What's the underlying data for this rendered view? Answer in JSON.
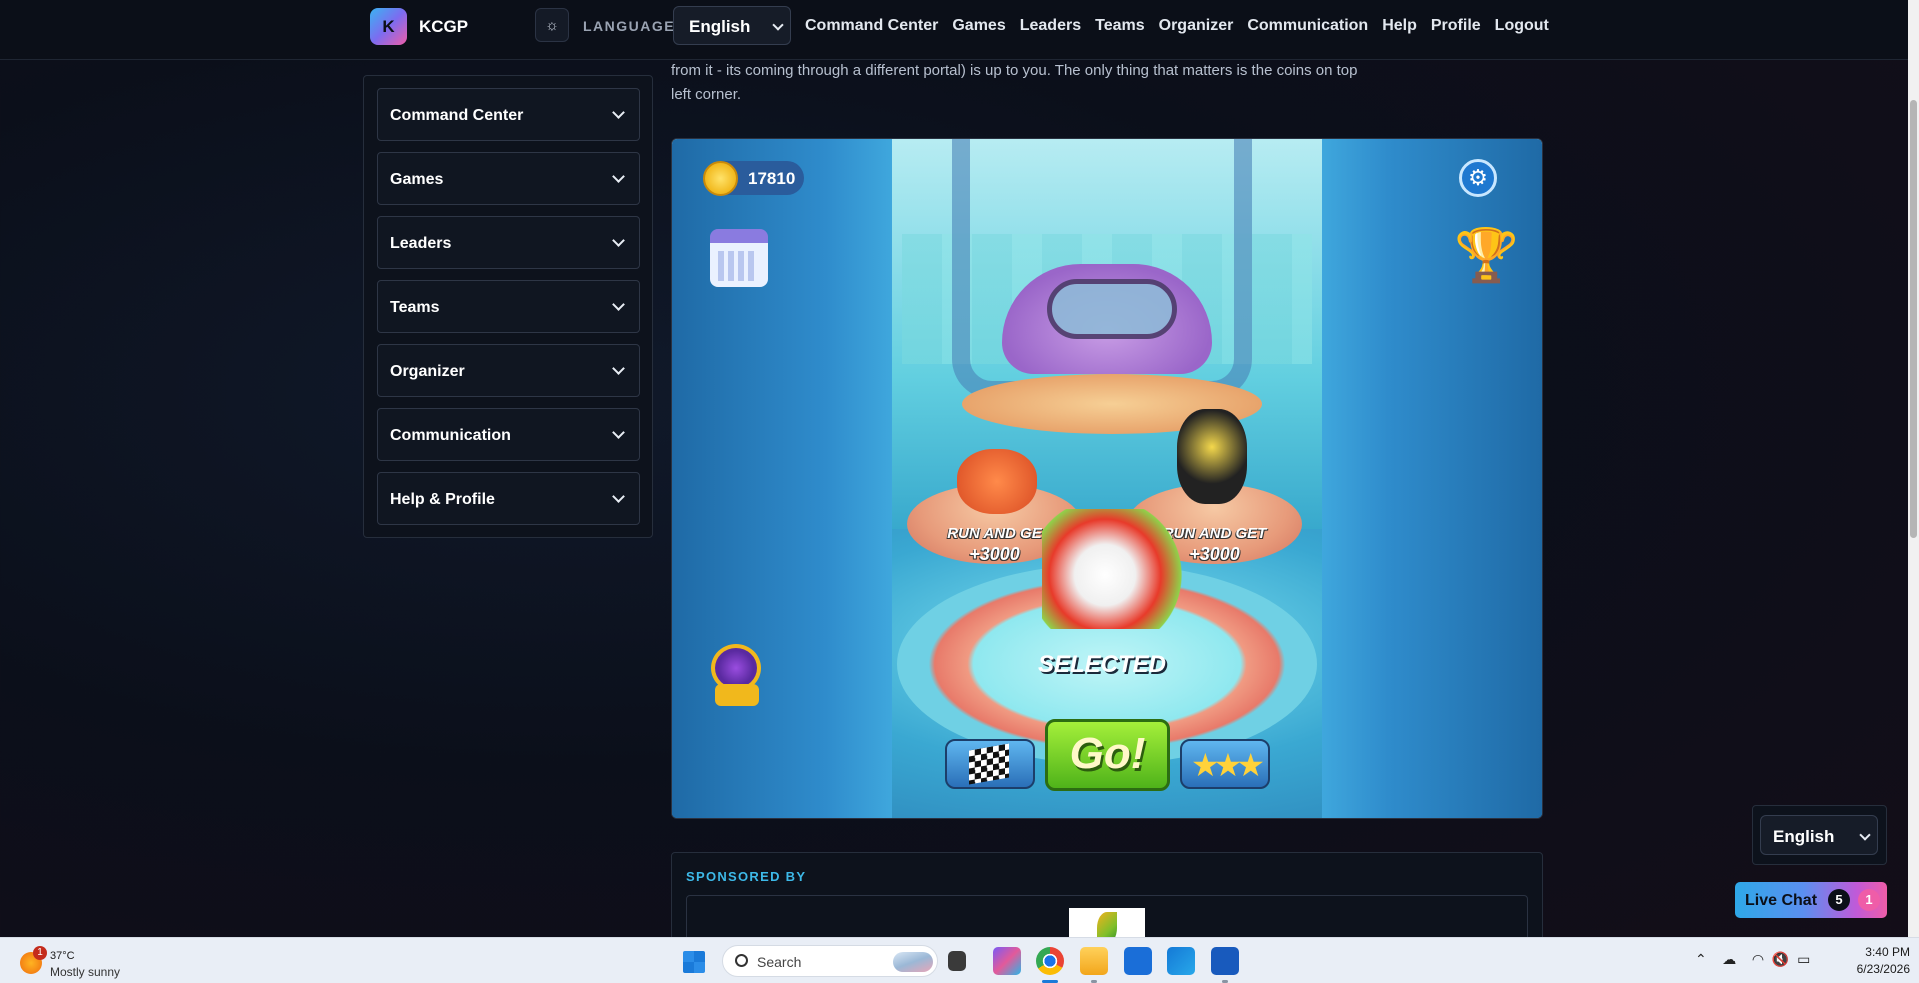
{
  "brand": {
    "logo_letter": "K",
    "name": "KCGP"
  },
  "topnav": {
    "theme_icon": "sun-icon",
    "language_label": "LANGUAGE",
    "language_value": "English",
    "links": [
      "Command Center",
      "Games",
      "Leaders",
      "Teams",
      "Organizer",
      "Communication",
      "Help",
      "Profile",
      "Logout"
    ]
  },
  "sidebar": {
    "items": [
      {
        "label": "Command Center"
      },
      {
        "label": "Games"
      },
      {
        "label": "Leaders"
      },
      {
        "label": "Teams"
      },
      {
        "label": "Organizer"
      },
      {
        "label": "Communication"
      },
      {
        "label": "Help & Profile"
      }
    ]
  },
  "intro": {
    "line1": "from it - its coming through a different portal) is up to you. The only thing that matters is the coins on top",
    "line2": "left corner."
  },
  "game": {
    "coins": "17810",
    "pedestal_left": {
      "line1": "RUN AND GE",
      "line2": "+3000"
    },
    "pedestal_right": {
      "line1": "RUN AND GET",
      "line2": "+3000"
    },
    "selected_label": "SELECTED",
    "go_label": "Go!",
    "icons": [
      "coin-icon",
      "gear-icon",
      "trophy-icon",
      "calendar-icon",
      "bonus-orb-icon",
      "checkered-flag-icon",
      "stars-icon"
    ]
  },
  "sponsor": {
    "title": "SPONSORED BY"
  },
  "floating": {
    "language_value": "English",
    "live_chat_label": "Live Chat",
    "chat_count_a": "5",
    "chat_count_b": "1"
  },
  "taskbar": {
    "weather_badge": "1",
    "temperature": "37°C",
    "condition": "Mostly sunny",
    "search_placeholder": "Search",
    "time": "3:40 PM",
    "date": "6/23/2026"
  },
  "colors": {
    "accent_blue": "#3db9e8",
    "accent_pink": "#ef5da8",
    "page_bg": "#0b0f1a"
  }
}
